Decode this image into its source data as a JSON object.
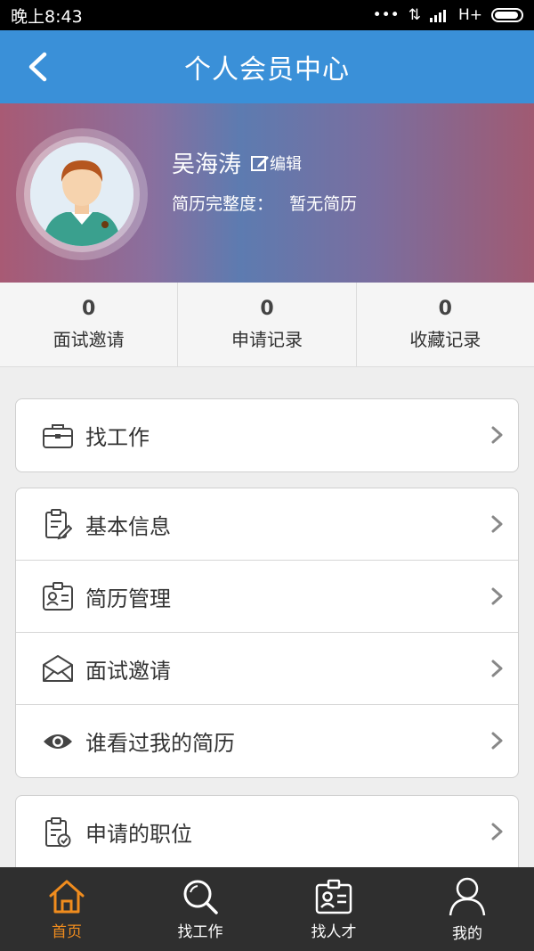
{
  "status": {
    "time": "晚上8:43",
    "network": "H+"
  },
  "header": {
    "title": "个人会员中心"
  },
  "profile": {
    "name": "吴海涛",
    "edit_label": "编辑",
    "resume_label": "简历完整度：",
    "resume_value": "暂无简历"
  },
  "stats": [
    {
      "count": "0",
      "label": "面试邀请"
    },
    {
      "count": "0",
      "label": "申请记录"
    },
    {
      "count": "0",
      "label": "收藏记录"
    }
  ],
  "menu": {
    "find_job": "找工作",
    "basic_info": "基本信息",
    "resume_manage": "简历管理",
    "interview_invite": "面试邀请",
    "who_viewed": "谁看过我的简历",
    "applied_positions": "申请的职位"
  },
  "tabs": [
    {
      "label": "首页",
      "icon": "home-icon",
      "active": true
    },
    {
      "label": "找工作",
      "icon": "search-icon",
      "active": false
    },
    {
      "label": "找人才",
      "icon": "id-card-icon",
      "active": false
    },
    {
      "label": "我的",
      "icon": "person-icon",
      "active": false
    }
  ],
  "colors": {
    "header": "#3a90d8",
    "active_tab": "#f08c1e",
    "tabbar": "#2f2f2f"
  }
}
